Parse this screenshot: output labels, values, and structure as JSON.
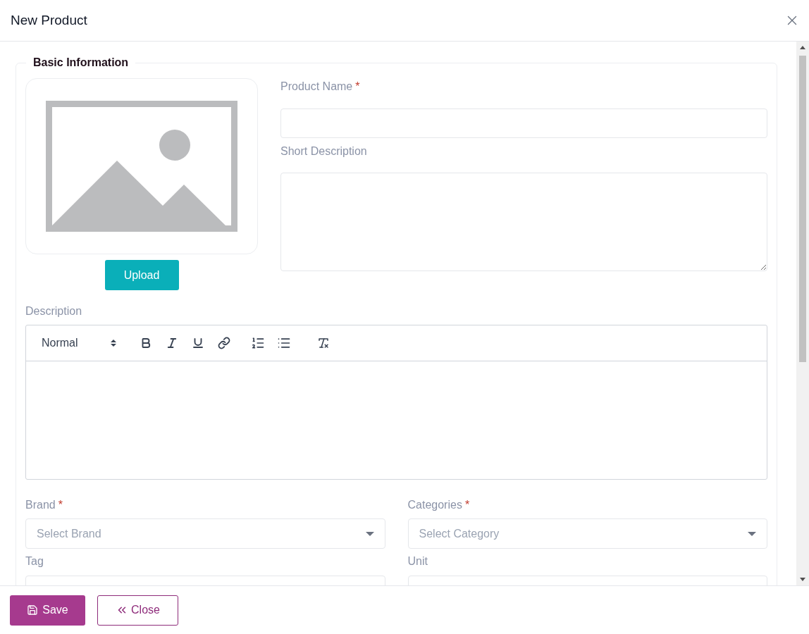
{
  "dialog": {
    "title": "New Product"
  },
  "section": {
    "title": "Basic Information"
  },
  "upload_button": "Upload",
  "top_fields": [
    {
      "label": "Product Name",
      "required_mark": "*",
      "kind": "input"
    },
    {
      "label": "Short Description",
      "kind": "textarea"
    }
  ],
  "description": {
    "label": "Description",
    "editor": {
      "style_select": "Normal"
    }
  },
  "select_fields": [
    {
      "label": "Brand",
      "required_mark": "*",
      "placeholder": "Select Brand",
      "kind": "select"
    },
    {
      "label": "Categories",
      "required_mark": "*",
      "placeholder": "Select Category",
      "kind": "select"
    },
    {
      "label": "Tag",
      "kind": "cut"
    },
    {
      "label": "Unit",
      "kind": "cut"
    }
  ],
  "footer": {
    "save": "Save",
    "close": "Close"
  }
}
